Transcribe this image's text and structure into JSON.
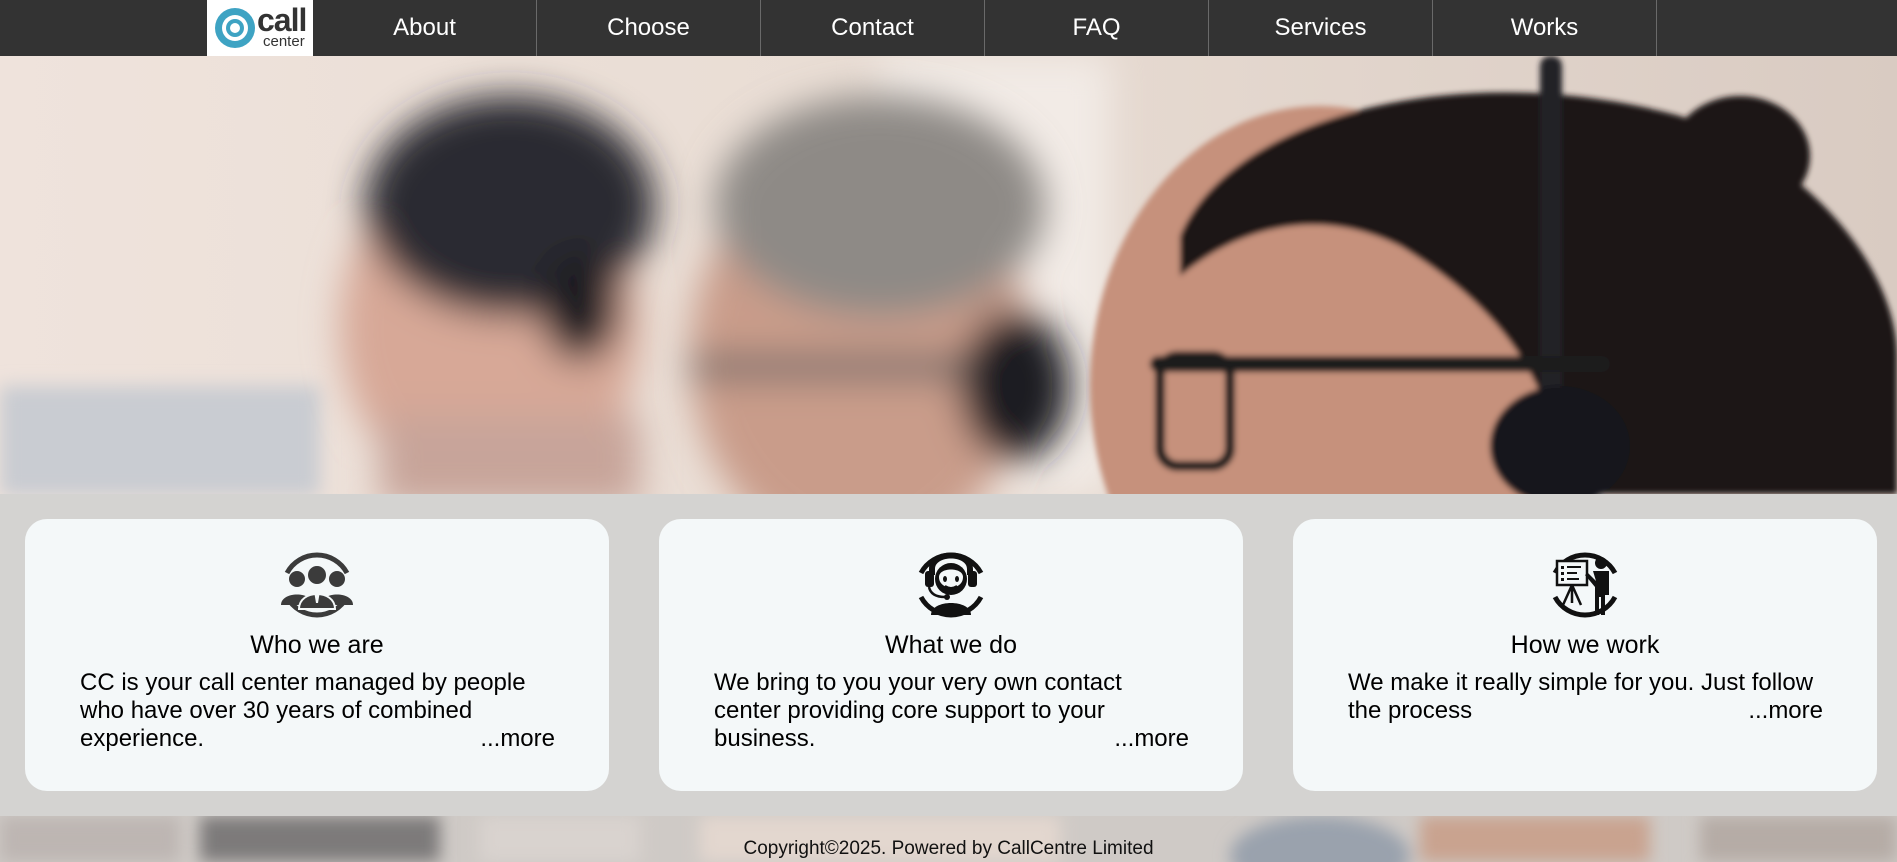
{
  "brand": {
    "logo_call": "call",
    "logo_center": "center"
  },
  "nav": {
    "items": [
      {
        "label": "About"
      },
      {
        "label": "Choose"
      },
      {
        "label": "Contact"
      },
      {
        "label": "FAQ"
      },
      {
        "label": "Services"
      },
      {
        "label": "Works"
      }
    ]
  },
  "cards": [
    {
      "icon": "team-icon",
      "title": "Who we are",
      "text": "CC is your call center managed by people who have over 30 years of combined experience.",
      "more": "...more"
    },
    {
      "icon": "headset-agent-icon",
      "title": "What we do",
      "text": "We bring to you your very own contact center providing core support to your business.",
      "more": "...more"
    },
    {
      "icon": "presenter-icon",
      "title": "How we work",
      "text": "We make it really simple for you. Just follow the process",
      "more": "...more"
    }
  ],
  "footer": {
    "copyright": "Copyright©2025. Powered by CallCentre Limited"
  },
  "colors": {
    "nav_bg": "#333333",
    "band_bg": "#d4d3d1",
    "card_bg": "#f4f8f9",
    "logo_accent": "#3ea3c3"
  }
}
